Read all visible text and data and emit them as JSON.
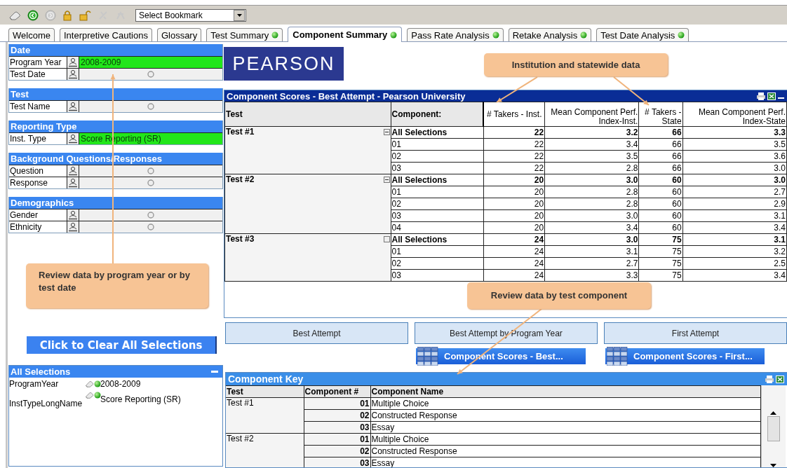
{
  "toolbar": {
    "bookmark": {
      "value": "Select Bookmark"
    }
  },
  "tabs": [
    {
      "label": "Welcome",
      "selected": false,
      "status_dot": false
    },
    {
      "label": "Interpretive Cautions",
      "selected": false,
      "status_dot": false
    },
    {
      "label": "Glossary",
      "selected": false,
      "status_dot": false
    },
    {
      "label": "Test Summary",
      "selected": false,
      "status_dot": true
    },
    {
      "label": "Component Summary",
      "selected": true,
      "status_dot": true
    },
    {
      "label": "Pass Rate Analysis",
      "selected": false,
      "status_dot": true
    },
    {
      "label": "Retake Analysis",
      "selected": false,
      "status_dot": true
    },
    {
      "label": "Test Date Analysis",
      "selected": false,
      "status_dot": true
    }
  ],
  "filters": [
    {
      "title": "Date",
      "fields": [
        {
          "label": "Program Year",
          "selected": true,
          "value": "2008-2009"
        },
        {
          "label": "Test Date",
          "selected": false
        }
      ]
    },
    {
      "title": "Test",
      "fields": [
        {
          "label": "Test Name",
          "selected": false
        }
      ]
    },
    {
      "title": "Reporting Type",
      "fields": [
        {
          "label": "Inst. Type",
          "selected": true,
          "value": "Score Reporting (SR)"
        }
      ]
    },
    {
      "title": "Background Questions/Responses",
      "fields": [
        {
          "label": "Question",
          "selected": false
        },
        {
          "label": "Response",
          "selected": false
        }
      ]
    },
    {
      "title": "Demographics",
      "fields": [
        {
          "label": "Gender",
          "selected": false
        },
        {
          "label": "Ethnicity",
          "selected": false
        }
      ]
    }
  ],
  "clear_button": {
    "label": "Click to Clear All Selections"
  },
  "all_selections": {
    "title": "All Selections",
    "items": [
      {
        "field": "ProgramYear",
        "value": "2008-2009"
      },
      {
        "field": "InstTypeLongName",
        "value": "Score Reporting (SR)"
      }
    ]
  },
  "logo": "PEARSON",
  "scores_table": {
    "title": "Component Scores - Best Attempt - Pearson University",
    "columns": [
      "Test",
      "Component:",
      "# Takers - Inst.",
      "Mean Component Perf. Index-Inst.",
      "# Takers - State",
      "Mean Component Perf. Index-State"
    ],
    "groups": [
      {
        "test": "Test #1",
        "expanded": true,
        "rows": [
          {
            "kind": "total",
            "component": "All Selections",
            "values": [
              "22",
              "3.2",
              "66",
              "3.3"
            ]
          },
          {
            "kind": "item",
            "component": "01",
            "values": [
              "22",
              "3.4",
              "66",
              "3.5"
            ]
          },
          {
            "kind": "item",
            "component": "02",
            "values": [
              "22",
              "3.5",
              "66",
              "3.6"
            ]
          },
          {
            "kind": "item",
            "component": "03",
            "values": [
              "22",
              "2.8",
              "66",
              "3.0"
            ]
          }
        ]
      },
      {
        "test": "Test #2",
        "expanded": true,
        "rows": [
          {
            "kind": "total",
            "component": "All Selections",
            "values": [
              "20",
              "3.0",
              "60",
              "3.0"
            ]
          },
          {
            "kind": "item",
            "component": "01",
            "values": [
              "20",
              "2.8",
              "60",
              "2.7"
            ]
          },
          {
            "kind": "item",
            "component": "02",
            "values": [
              "20",
              "2.8",
              "60",
              "2.9"
            ]
          },
          {
            "kind": "item",
            "component": "03",
            "values": [
              "20",
              "3.0",
              "60",
              "3.1"
            ]
          },
          {
            "kind": "item",
            "component": "04",
            "values": [
              "20",
              "3.4",
              "60",
              "3.4"
            ]
          }
        ]
      },
      {
        "test": "Test #3",
        "expanded": false,
        "rows": [
          {
            "kind": "total",
            "component": "All Selections",
            "values": [
              "24",
              "3.0",
              "75",
              "3.1"
            ]
          },
          {
            "kind": "item",
            "component": "01",
            "values": [
              "24",
              "3.1",
              "75",
              "3.2"
            ]
          },
          {
            "kind": "item",
            "component": "02",
            "values": [
              "24",
              "2.7",
              "75",
              "2.5"
            ]
          },
          {
            "kind": "item",
            "component": "03",
            "values": [
              "24",
              "3.3",
              "75",
              "3.4"
            ]
          }
        ]
      }
    ]
  },
  "view_buttons": [
    "Best Attempt",
    "Best Attempt by Program Year",
    "First Attempt"
  ],
  "report_buttons": [
    "Component Scores - Best...",
    "Component Scores - First..."
  ],
  "key_table": {
    "title": "Component Key",
    "columns": [
      "Test",
      "Component #",
      "Component Name"
    ],
    "groups": [
      {
        "test": "Test #1",
        "rows": [
          {
            "number": "01",
            "name": "Multiple Choice"
          },
          {
            "number": "02",
            "name": "Constructed Response"
          },
          {
            "number": "03",
            "name": "Essay"
          }
        ]
      },
      {
        "test": "Test #2",
        "rows": [
          {
            "number": "01",
            "name": "Multiple Choice"
          },
          {
            "number": "02",
            "name": "Constructed Response"
          },
          {
            "number": "03",
            "name": "Essay"
          }
        ]
      }
    ]
  },
  "callouts": [
    {
      "text": "Institution and statewide data"
    },
    {
      "text": "Review data by program year or by test date"
    },
    {
      "text": "Review data by test component"
    }
  ]
}
